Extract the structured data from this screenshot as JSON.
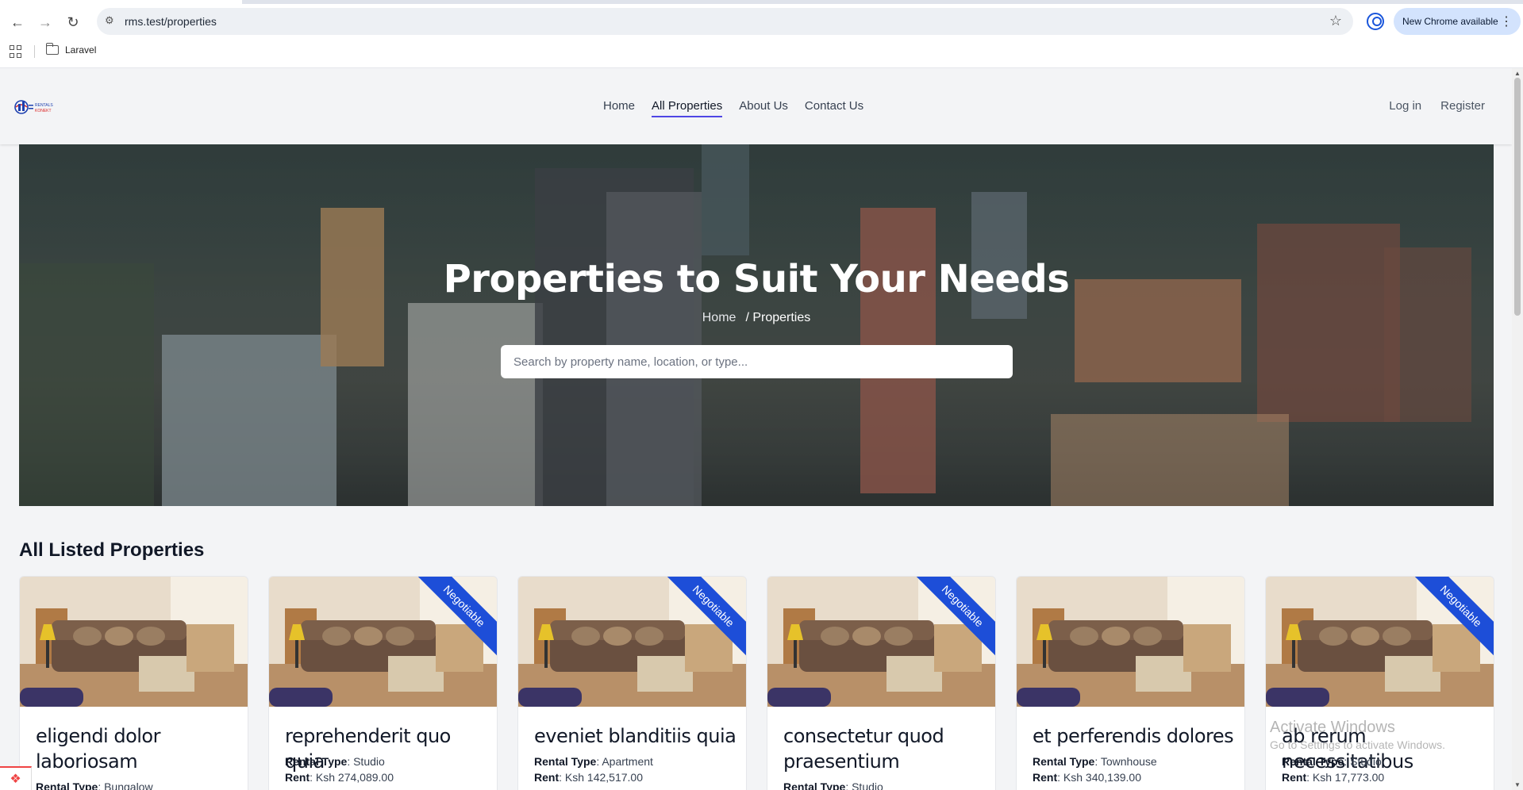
{
  "browser": {
    "url": "rms.test/properties",
    "update_label": "New Chrome available",
    "bookmark_folder": "Laravel"
  },
  "site": {
    "logo_alt": "Rentals Konekt",
    "nav": [
      {
        "label": "Home",
        "active": false
      },
      {
        "label": "All Properties",
        "active": true
      },
      {
        "label": "About Us",
        "active": false
      },
      {
        "label": "Contact Us",
        "active": false
      }
    ],
    "auth": {
      "login": "Log in",
      "register": "Register"
    }
  },
  "hero": {
    "title": "Properties to Suit Your Needs",
    "breadcrumb_home": "Home",
    "breadcrumb_current": "/ Properties",
    "search_placeholder": "Search by property name, location, or type..."
  },
  "listing": {
    "section_title": "All Listed Properties",
    "labels": {
      "rental_type": "Rental Type",
      "rent": "Rent"
    },
    "cards": [
      {
        "title": "eligendi dolor laboriosam",
        "negotiable": false,
        "rental_type": "Bungalow",
        "rent": ""
      },
      {
        "title": "reprehenderit quo quia",
        "negotiable": true,
        "ribbon": "Negotiable",
        "rental_type": "Studio",
        "rent": "Ksh 274,089.00"
      },
      {
        "title": "eveniet blanditiis quia",
        "negotiable": true,
        "ribbon": "Negotiable",
        "rental_type": "Apartment",
        "rent": "Ksh 142,517.00"
      },
      {
        "title": "consectetur quod praesentium",
        "negotiable": true,
        "ribbon": "Negotiable",
        "rental_type": "Studio",
        "rent": ""
      },
      {
        "title": "et perferendis dolores",
        "negotiable": false,
        "rental_type": "Townhouse",
        "rent": "Ksh 340,139.00"
      },
      {
        "title": "ab rerum necessitatibus",
        "negotiable": true,
        "ribbon": "Negotiable",
        "rental_type": "Studio",
        "rent": "Ksh 17,773.00"
      }
    ]
  },
  "watermark": {
    "line1": "Activate Windows",
    "line2": "Go to Settings to activate Windows."
  },
  "colors": {
    "accent": "#4f46e5",
    "ribbon": "#1d4ed8"
  }
}
